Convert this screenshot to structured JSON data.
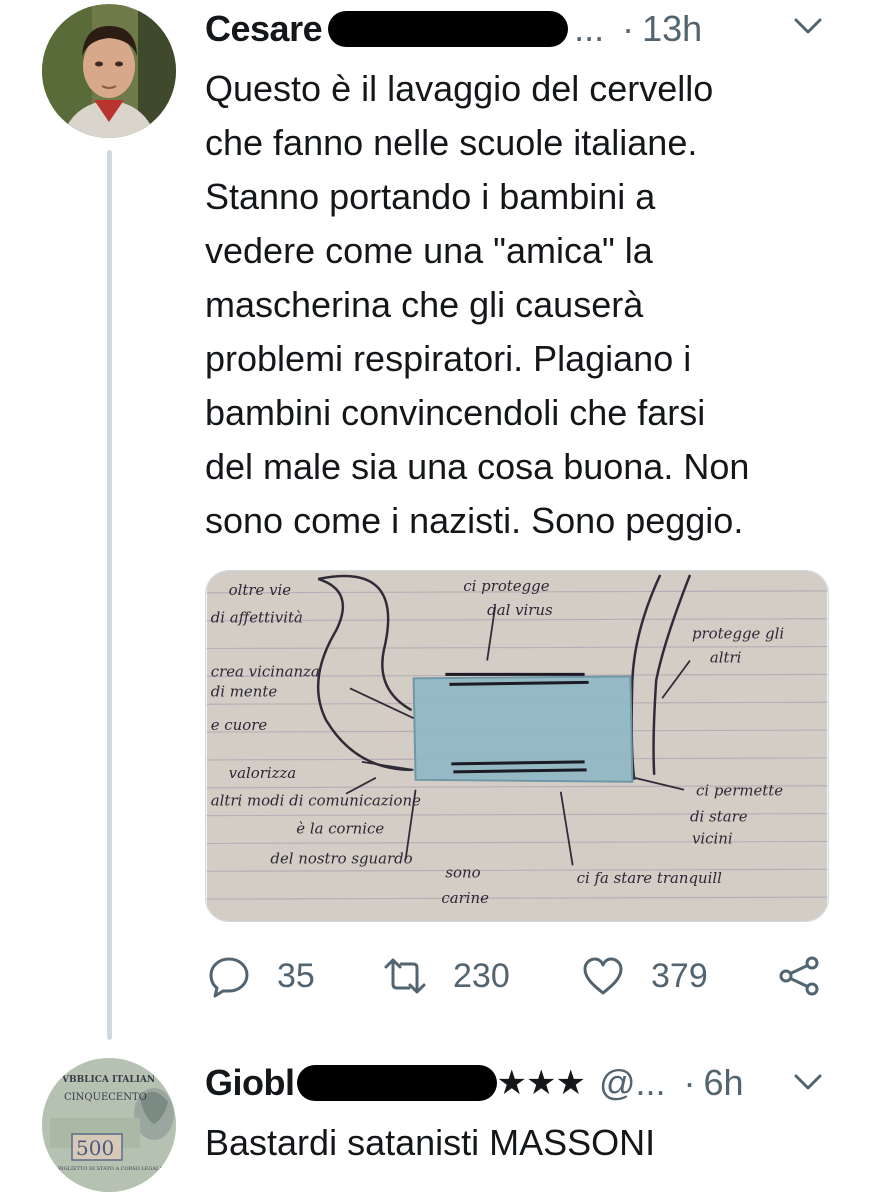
{
  "tweets": [
    {
      "name": "Cesare",
      "ellipsis": "...",
      "separator": "·",
      "time": "13h",
      "text": "Questo è il lavaggio del cervello\nche fanno nelle scuole italiane.\nStanno portando i bambini a\nvedere come una \"amica\" la\nmascherina che gli causerà\nproblemi respiratori. Plagiano i\nbambini convincendoli che farsi\ndel male sia una cosa buona. Non\nsono come i nazisti. Sono peggio.",
      "media_notes": [
        "oltre vie",
        "di affettività",
        "crea vicinanza",
        "di mente",
        "e cuore",
        "valorizza",
        "altri modi di comunicazione",
        "è la cornice",
        "del nostro sguardo",
        "sono",
        "carine",
        "ci protegge",
        "dal virus",
        "protegge gli",
        "altri",
        "ci permette",
        "di stare",
        "vicini",
        "ci fa stare tranquill"
      ],
      "actions": {
        "replies": "35",
        "retweets": "230",
        "likes": "379"
      }
    },
    {
      "name": "Giobl",
      "stars": "★★★",
      "handle": "@...",
      "separator": "·",
      "time": "6h",
      "text": "Bastardi satanisti MASSONI",
      "avatar_text": {
        "top": "VBBLICA ITALIAN",
        "middle": "CINQUECENTO",
        "value": "500",
        "bottom": "BIGLIETTO DI STATO A CORSO LEGALE"
      }
    }
  ],
  "colors": {
    "text": "#14171a",
    "secondary": "#536471",
    "divider": "#cfd9de",
    "mask_blue": "#8fb8c4"
  },
  "icons": [
    "chevron-down-icon",
    "reply-icon",
    "retweet-icon",
    "like-icon",
    "share-icon"
  ]
}
